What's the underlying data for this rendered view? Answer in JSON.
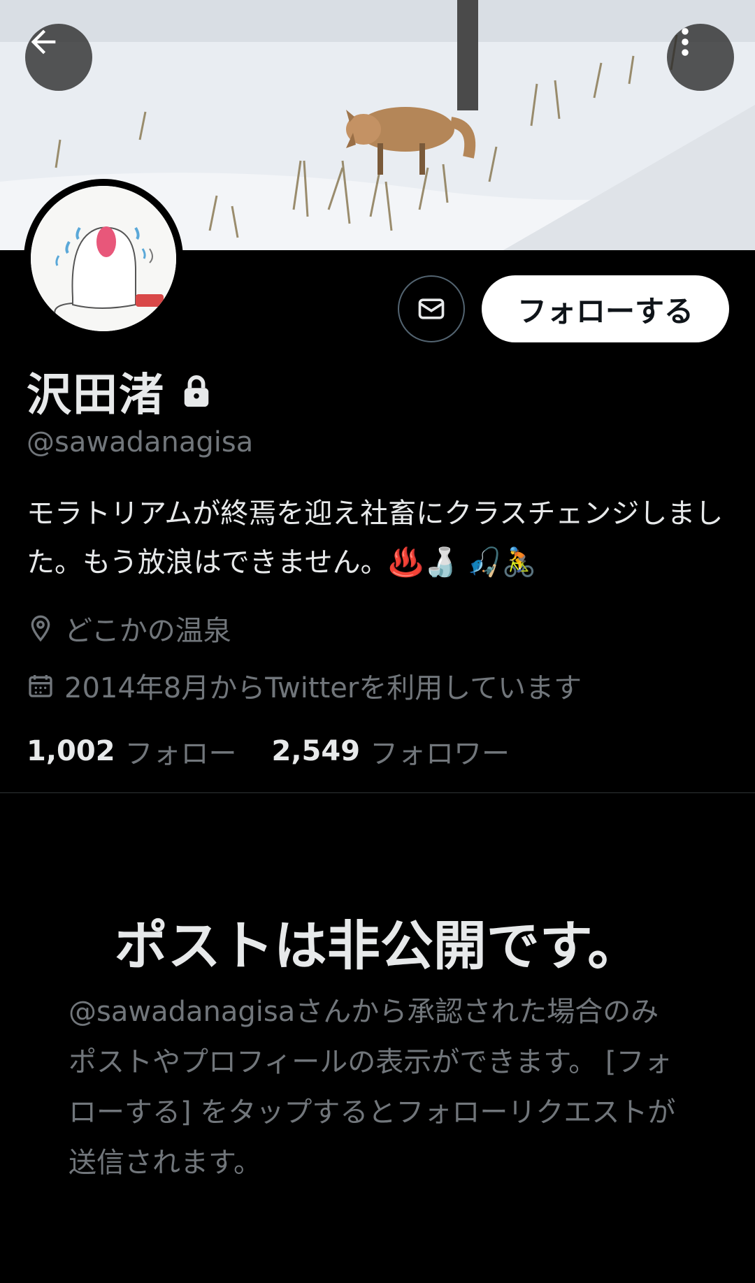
{
  "header": {
    "back_icon": "arrow-left-icon",
    "more_icon": "more-vertical-icon"
  },
  "profile": {
    "display_name": "沢田渚",
    "lock_icon": "lock-icon",
    "handle": "@sawadanagisa",
    "bio": "モラトリアムが終焉を迎え社畜にクラスチェンジしました。もう放浪はできません。♨️🍶 🎣🚴",
    "location": "どこかの温泉",
    "joined": "2014年8月からTwitterを利用しています",
    "following_count": "1,002",
    "following_label": "フォロー",
    "followers_count": "2,549",
    "followers_label": "フォロワー"
  },
  "actions": {
    "message_icon": "envelope-icon",
    "follow_label": "フォローする"
  },
  "private_notice": {
    "title": "ポストは非公開です。",
    "description": "@sawadanagisaさんから承認された場合のみポストやプロフィールの表示ができます。 [フォローする] をタップするとフォローリクエストが送信されます。"
  },
  "colors": {
    "background": "#000000",
    "primary_text": "#e7e9ea",
    "secondary_text": "#71767b",
    "divider": "#2f3336"
  }
}
